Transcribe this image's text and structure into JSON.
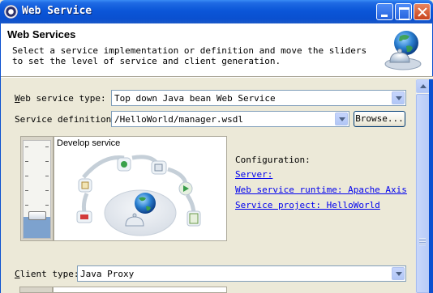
{
  "window": {
    "title": "Web Service",
    "icon": "eclipse-icon",
    "controls": [
      "minimize",
      "maximize",
      "close"
    ]
  },
  "header": {
    "title": "Web Services",
    "description": "Select a service implementation or definition and move the sliders to set the level of service and client generation.",
    "banner_icon": "web-service-globe-icon"
  },
  "form": {
    "service_type": {
      "label_prefix": "",
      "mnemonic": "W",
      "label_rest": "eb service type:",
      "value": "Top down Java bean Web Service"
    },
    "service_definition": {
      "label": "Service definition:",
      "value": "/HelloWorld/manager.wsdl",
      "browse_label": "Browse..."
    },
    "service_slider": {
      "illustration_title": "Develop service",
      "level": "develop"
    },
    "configuration": {
      "heading": "Configuration:",
      "server_link": "Server:",
      "runtime_link": "Web service runtime: Apache Axis",
      "project_link": "Service project: HelloWorld"
    },
    "client_type": {
      "mnemonic": "C",
      "label_rest": "lient type:",
      "value": "Java Proxy"
    }
  },
  "colors": {
    "titlebar": "#0a50d0",
    "dialog_bg": "#ece9d8",
    "link": "#0000ee",
    "slider_fill": "#7da2ce"
  }
}
